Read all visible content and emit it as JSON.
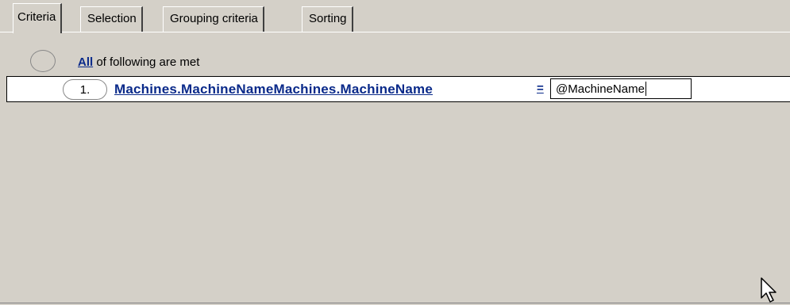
{
  "tabs": [
    {
      "label": "Criteria",
      "active": true
    },
    {
      "label": "Selection",
      "active": false
    },
    {
      "label": "Grouping criteria",
      "active": false
    },
    {
      "label": "Sorting",
      "active": false
    }
  ],
  "group": {
    "quantifier_link": "All",
    "condition_text": " of following are met"
  },
  "criteria": [
    {
      "number": "1.",
      "field": "Machines.MachineNameMachines.MachineName",
      "operator": "=",
      "value": "@MachineName"
    }
  ],
  "colors": {
    "background": "#d4d0c8",
    "link": "#0a2a8a",
    "row_background": "#ffffff"
  },
  "icons": {
    "cursor": "mouse-pointer-icon"
  }
}
